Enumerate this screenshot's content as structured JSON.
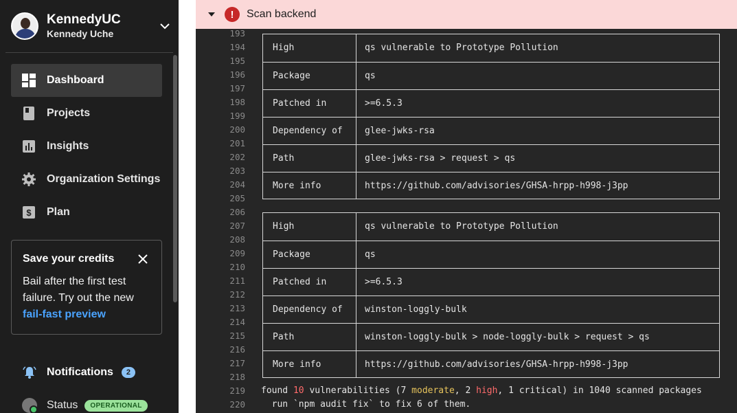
{
  "user": {
    "name": "KennedyUC",
    "subname": "Kennedy Uche"
  },
  "nav": [
    {
      "label": "Dashboard",
      "icon": "dashboard-icon",
      "active": true
    },
    {
      "label": "Projects",
      "icon": "book-icon"
    },
    {
      "label": "Insights",
      "icon": "chart-icon"
    },
    {
      "label": "Organization Settings",
      "icon": "gear-icon"
    },
    {
      "label": "Plan",
      "icon": "dollar-icon"
    }
  ],
  "promo": {
    "title": "Save your credits",
    "body": "Bail after the first test failure. Try out the new",
    "link": "fail-fast preview"
  },
  "notifications": {
    "label": "Notifications",
    "count": "2"
  },
  "status": {
    "label": "Status",
    "badge": "OPERATIONAL"
  },
  "job": {
    "title": "Scan backend"
  },
  "log": {
    "first_line_no": "193",
    "line_numbers": [
      "193",
      "194",
      "195",
      "196",
      "197",
      "198",
      "199",
      "200",
      "201",
      "202",
      "203",
      "204",
      "205",
      "206",
      "207",
      "208",
      "209",
      "210",
      "211",
      "212",
      "213",
      "214",
      "215",
      "216",
      "217",
      "218",
      "219",
      "220"
    ],
    "tables": [
      {
        "rows": [
          {
            "key": "High",
            "value": "qs vulnerable to Prototype Pollution"
          },
          {
            "key": "Package",
            "value": "qs"
          },
          {
            "key": "Patched in",
            "value": ">=6.5.3"
          },
          {
            "key": "Dependency of",
            "value": "glee-jwks-rsa"
          },
          {
            "key": "Path",
            "value": "glee-jwks-rsa > request > qs"
          },
          {
            "key": "More info",
            "value": "https://github.com/advisories/GHSA-hrpp-h998-j3pp"
          }
        ]
      },
      {
        "rows": [
          {
            "key": "High",
            "value": "qs vulnerable to Prototype Pollution"
          },
          {
            "key": "Package",
            "value": "qs"
          },
          {
            "key": "Patched in",
            "value": ">=6.5.3"
          },
          {
            "key": "Dependency of",
            "value": "winston-loggly-bulk"
          },
          {
            "key": "Path",
            "value": "winston-loggly-bulk > node-loggly-bulk > request > qs"
          },
          {
            "key": "More info",
            "value": "https://github.com/advisories/GHSA-hrpp-h998-j3pp"
          }
        ]
      }
    ],
    "summary": {
      "pre": "found ",
      "count": "10",
      "mid1": " vulnerabilities (7 ",
      "moderate": "moderate",
      "mid2": ", 2 ",
      "high": "high",
      "mid3": ", 1 critical) in 1040 scanned packages"
    },
    "fix_line": "  run `npm audit fix` to fix 6 of them."
  },
  "colors": {
    "sidebar": "#1e1e1e",
    "header_bg": "#fbd8d8",
    "error": "#c62828",
    "link": "#4aa3ff",
    "log_bg": "#262626"
  }
}
